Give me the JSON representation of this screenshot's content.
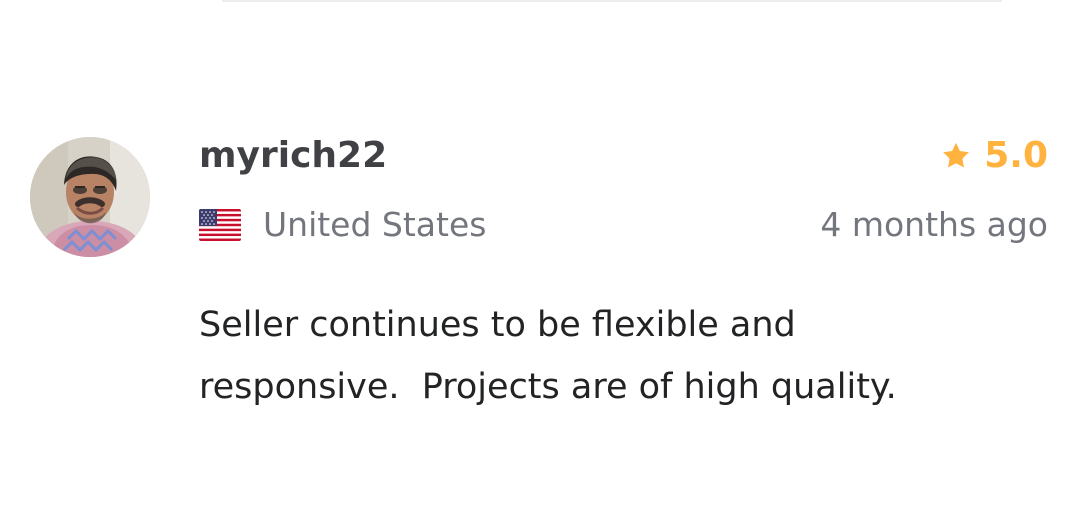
{
  "review": {
    "username": "myrich22",
    "rating": "5.0",
    "country": "United States",
    "time_ago": "4 months ago",
    "text": "Seller continues to be flexible and\nresponsive.  Projects are of high quality."
  },
  "icons": {
    "avatar": "user-avatar",
    "flag": "us-flag-icon",
    "star": "star-icon"
  },
  "colors": {
    "star": "#ffb33e",
    "username": "#404145",
    "muted_text": "#74767e",
    "body_text": "#222325"
  }
}
